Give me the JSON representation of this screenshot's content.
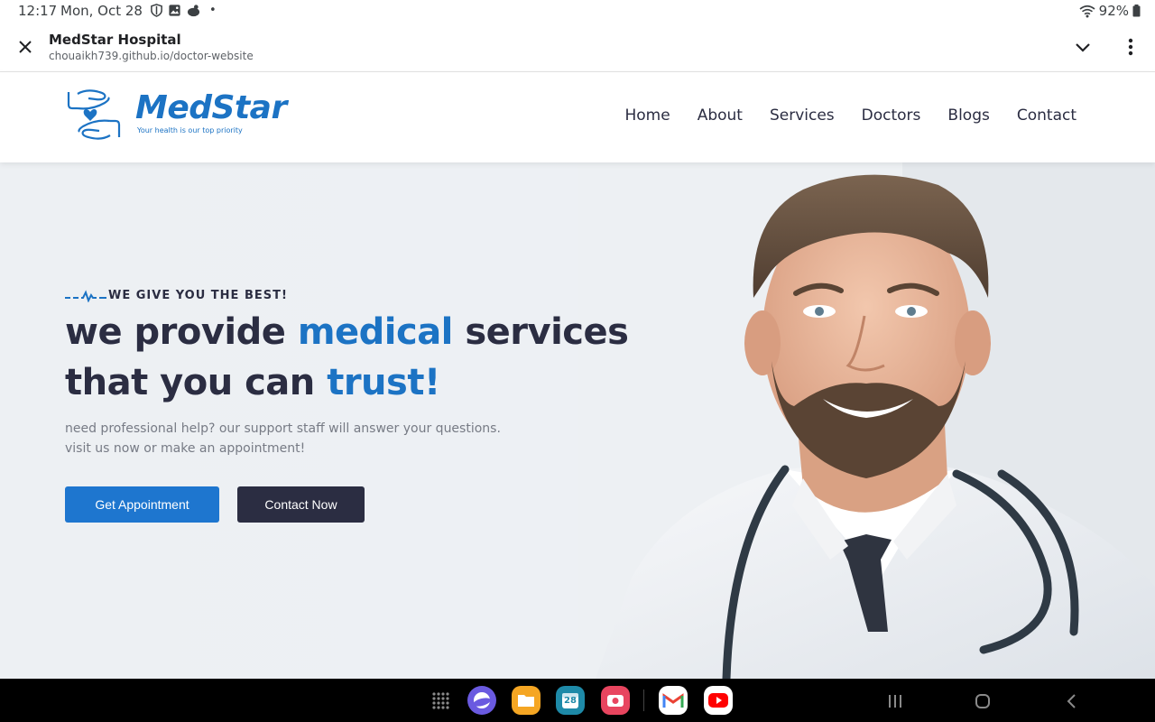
{
  "status_bar": {
    "time": "12:17",
    "date": "Mon, Oct 28",
    "battery": "92%"
  },
  "browser": {
    "page_title": "MedStar Hospital",
    "url": "chouaikh739.github.io/doctor-website"
  },
  "site": {
    "logo_name": "MedStar",
    "logo_tagline": "Your health is our top priority",
    "nav": [
      "Home",
      "About",
      "Services",
      "Doctors",
      "Blogs",
      "Contact"
    ]
  },
  "hero": {
    "eyebrow": "WE GIVE YOU THE BEST!",
    "headline_1a": "we provide ",
    "headline_1b": "medical",
    "headline_1c": " services",
    "headline_2a": "that you can ",
    "headline_2b": "trust!",
    "sub_line_1": "need professional help? our support staff will answer your questions.",
    "sub_line_2": "visit us now or make an appointment!",
    "btn_primary": "Get Appointment",
    "btn_secondary": "Contact Now"
  },
  "dock": {
    "apps": [
      "app-drawer-icon",
      "internet-icon",
      "my-files-icon",
      "calendar-icon",
      "screen-recorder-icon",
      "gmail-icon",
      "youtube-icon"
    ],
    "calendar_day": "28"
  },
  "colors": {
    "brand_blue": "#1c73c4",
    "dark_navy": "#2b2d42",
    "hero_bg": "#edf0f3"
  }
}
